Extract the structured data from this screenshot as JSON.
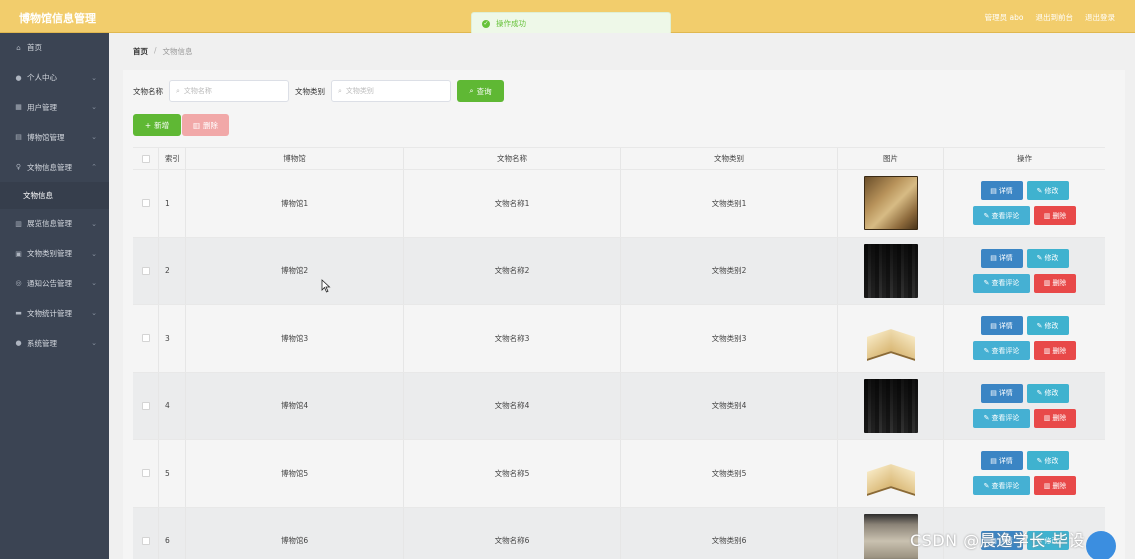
{
  "header": {
    "title": "博物馆信息管理",
    "admin_label": "管理员 abo",
    "exit_frontend": "退出到前台",
    "logout": "退出登录"
  },
  "toast": {
    "message": "操作成功"
  },
  "sidebar": {
    "items": [
      {
        "icon": "home-icon",
        "label": "首页"
      },
      {
        "icon": "user-icon",
        "label": "个人中心"
      },
      {
        "icon": "users-icon",
        "label": "用户管理"
      },
      {
        "icon": "museum-icon",
        "label": "博物馆管理"
      },
      {
        "icon": "artifact-icon",
        "label": "文物信息管理"
      },
      {
        "icon": "exhibition-icon",
        "label": "展览信息管理"
      },
      {
        "icon": "category-icon",
        "label": "文物类别管理"
      },
      {
        "icon": "notice-icon",
        "label": "通知公告管理"
      },
      {
        "icon": "stats-icon",
        "label": "文物统计管理"
      },
      {
        "icon": "system-icon",
        "label": "系统管理"
      }
    ],
    "sub_item": "文物信息"
  },
  "breadcrumb": {
    "home": "首页",
    "separator": "/",
    "current": "文物信息"
  },
  "search": {
    "name_label": "文物名称",
    "name_placeholder": "文物名称",
    "type_label": "文物类别",
    "type_placeholder": "文物类别",
    "search_button": "查询"
  },
  "actions": {
    "add": "新增",
    "delete": "删除"
  },
  "table": {
    "headers": {
      "index": "索引",
      "museum": "博物馆",
      "name": "文物名称",
      "type": "文物类别",
      "image": "图片",
      "ops": "操作"
    },
    "rows": [
      {
        "index": "1",
        "museum": "博物馆1",
        "name": "文物名称1",
        "type": "文物类别1"
      },
      {
        "index": "2",
        "museum": "博物馆2",
        "name": "文物名称2",
        "type": "文物类别2"
      },
      {
        "index": "3",
        "museum": "博物馆3",
        "name": "文物名称3",
        "type": "文物类别3"
      },
      {
        "index": "4",
        "museum": "博物馆4",
        "name": "文物名称4",
        "type": "文物类别4"
      },
      {
        "index": "5",
        "museum": "博物馆5",
        "name": "文物名称5",
        "type": "文物类别5"
      },
      {
        "index": "6",
        "museum": "博物馆6",
        "name": "文物名称6",
        "type": "文物类别6"
      }
    ],
    "ops": {
      "detail": "详情",
      "edit": "修改",
      "comment": "查看评论",
      "delete": "删除"
    }
  },
  "watermark": "CSDN @晨逸学长-毕设",
  "colors": {
    "header": "#f2cd6c",
    "sidebar": "#3b4453",
    "green": "#5fb834",
    "danger": "#e84949",
    "primary": "#3b85c4",
    "info": "#3fb2cf"
  }
}
